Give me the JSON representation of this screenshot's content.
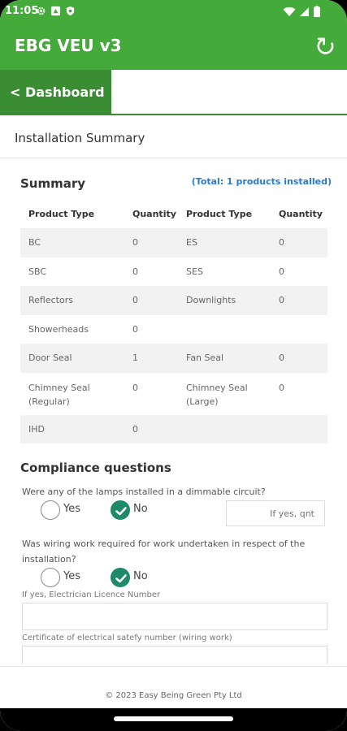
{
  "status": {
    "time": "11:05"
  },
  "app": {
    "title": "EBG VEU v3"
  },
  "nav": {
    "dashboard_label": "< Dashboard"
  },
  "section": {
    "title": "Installation Summary"
  },
  "summary": {
    "title": "Summary",
    "total": "(Total: 1 products installed)",
    "headers": [
      "Product Type",
      "Quantity",
      "Product Type",
      "Quantity"
    ],
    "rows": [
      [
        "BC",
        "0",
        "ES",
        "0"
      ],
      [
        "SBC",
        "0",
        "SES",
        "0"
      ],
      [
        "Reflectors",
        "0",
        "Downlights",
        "0"
      ],
      [
        "Showerheads",
        "0",
        "",
        ""
      ],
      [
        "Door Seal",
        "1",
        "Fan Seal",
        "0"
      ],
      [
        "Chimney Seal (Regular)",
        "0",
        "Chimney Seal (Large)",
        "0"
      ],
      [
        "IHD",
        "0",
        "",
        ""
      ]
    ]
  },
  "compliance": {
    "title": "Compliance questions",
    "q1": {
      "text": "Were any of the lamps installed in a dimmable circuit?",
      "yes_label": "Yes",
      "no_label": "No",
      "selected": "No",
      "qnt_placeholder": "If yes, qnt"
    },
    "q2": {
      "text": "Was wiring work required for work undertaken in respect of the installation?",
      "yes_label": "Yes",
      "no_label": "No",
      "selected": "No"
    },
    "licence_label": "If yes, Electrician Licence Number",
    "certificate_label": "Certificate of electrical satefy number (wiring work)"
  },
  "footer": {
    "copyright": "© 2023 Easy Being Green Pty Ltd"
  },
  "colors": {
    "primary": "#44aa3a",
    "tab": "#3b8d33",
    "link": "#2a7bd0",
    "radio_on": "#1e8a6a"
  }
}
